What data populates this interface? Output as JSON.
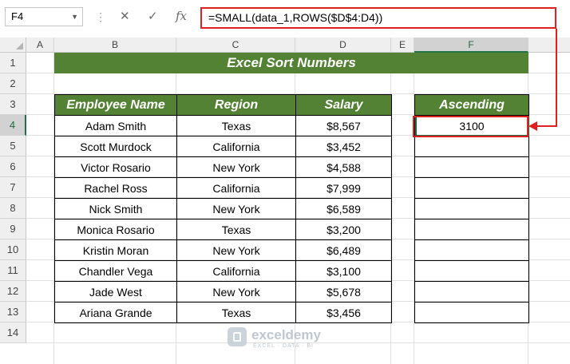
{
  "formula_bar": {
    "name_box": "F4",
    "formula": "=SMALL(data_1,ROWS($D$4:D4))",
    "cancel_icon": "✕",
    "enter_icon": "✓",
    "fx_label": "fx"
  },
  "columns": [
    "A",
    "B",
    "C",
    "D",
    "E",
    "F"
  ],
  "rows": [
    "1",
    "2",
    "3",
    "4",
    "5",
    "6",
    "7",
    "8",
    "9",
    "10",
    "11",
    "12",
    "13",
    "14"
  ],
  "selected_cell": {
    "column": "F",
    "row": "4"
  },
  "title": "Excel Sort Numbers",
  "table": {
    "headers": [
      "Employee Name",
      "Region",
      "Salary"
    ],
    "rows": [
      [
        "Adam Smith",
        "Texas",
        "$8,567"
      ],
      [
        "Scott Murdock",
        "California",
        "$3,452"
      ],
      [
        "Victor Rosario",
        "New York",
        "$4,588"
      ],
      [
        "Rachel Ross",
        "California",
        "$7,999"
      ],
      [
        "Nick Smith",
        "New York",
        "$6,589"
      ],
      [
        "Monica Rosario",
        "Texas",
        "$3,200"
      ],
      [
        "Kristin Moran",
        "New York",
        "$6,489"
      ],
      [
        "Chandler Vega",
        "California",
        "$3,100"
      ],
      [
        "Jade West",
        "New York",
        "$5,678"
      ],
      [
        "Ariana Grande",
        "Texas",
        "$3,456"
      ]
    ]
  },
  "ascending": {
    "header": "Ascending",
    "values": [
      "3100",
      "",
      "",
      "",
      "",
      "",
      "",
      "",
      "",
      ""
    ]
  },
  "watermark": {
    "name": "exceldemy",
    "tagline": "EXCEL · DATA · BI"
  },
  "colors": {
    "header_green": "#548235",
    "highlight_red": "#e02020",
    "selection_green": "#217346"
  }
}
